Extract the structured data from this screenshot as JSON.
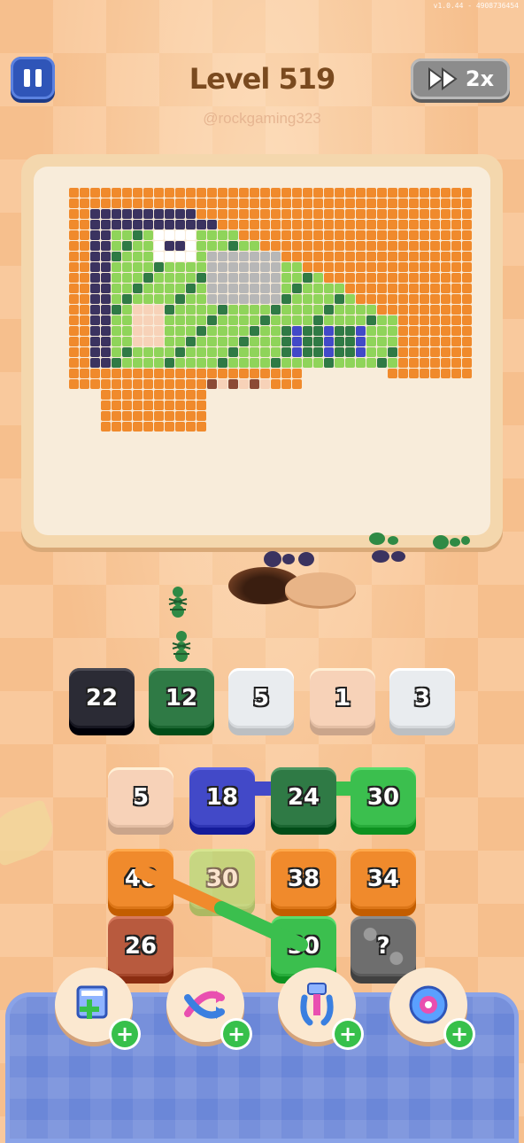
{
  "hud": {
    "version": "v1.0.44 - 4908736454",
    "level_title": "Level 519",
    "creator_handle": "@rockgaming323",
    "speed_label": "2x"
  },
  "queue_slots": [
    {
      "value": "22",
      "color": "#2b2b35"
    },
    {
      "value": "12",
      "color": "#2f7a45"
    },
    {
      "value": "5",
      "color": "#e9ecef"
    },
    {
      "value": "1",
      "color": "#f7d2b8"
    },
    {
      "value": "3",
      "color": "#e9ecef"
    }
  ],
  "grid_tiles": [
    {
      "value": "5",
      "color": "#f7d2b8"
    },
    {
      "value": "18",
      "color": "#4249c8"
    },
    {
      "value": "24",
      "color": "#2f7a45"
    },
    {
      "value": "30",
      "color": "#3bbf4e"
    },
    {
      "value": "40",
      "color": "#f08a2c"
    },
    {
      "value": "30",
      "color": "#9fe06a"
    },
    {
      "value": "38",
      "color": "#f08a2c"
    },
    {
      "value": "34",
      "color": "#f08a2c"
    },
    {
      "value": "26",
      "color": "#b85a3e"
    },
    {
      "value": "30",
      "color": "#3bbf4e"
    },
    {
      "value": "?",
      "color": "#6e6e6e"
    }
  ],
  "boosters": [
    {
      "name": "add-slot",
      "icon": "tray-plus-icon"
    },
    {
      "name": "shuffle",
      "icon": "shuffle-arrows-icon"
    },
    {
      "name": "claw",
      "icon": "claw-grabber-icon"
    },
    {
      "name": "magnet",
      "icon": "magnet-ring-icon"
    }
  ],
  "colors": {
    "pixel_orange": "#f08a2c",
    "pixel_dark_green": "#2f7a45",
    "pixel_light_green": "#8fd45a",
    "pixel_navy": "#3b3360",
    "pixel_blue": "#4249c8",
    "pixel_grey": "#b7b7b7",
    "pixel_white": "#ffffff",
    "pixel_brown": "#8b4a35",
    "pixel_peach": "#f7d2b8"
  }
}
